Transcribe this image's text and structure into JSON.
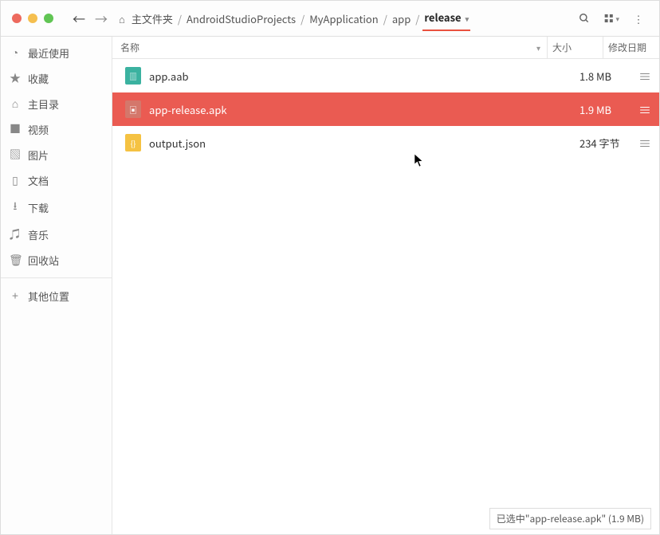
{
  "toolbar": {
    "back_enabled": true,
    "forward_enabled": false
  },
  "breadcrumb": {
    "home_label": "主文件夹",
    "sep": "/",
    "items": [
      "AndroidStudioProjects",
      "MyApplication",
      "app"
    ],
    "current": "release"
  },
  "sidebar": {
    "items": [
      {
        "icon": "recent",
        "label": "最近使用"
      },
      {
        "icon": "star",
        "label": "收藏"
      },
      {
        "icon": "home",
        "label": "主目录"
      },
      {
        "icon": "video",
        "label": "视频"
      },
      {
        "icon": "image",
        "label": "图片"
      },
      {
        "icon": "document",
        "label": "文档"
      },
      {
        "icon": "download",
        "label": "下载"
      },
      {
        "icon": "music",
        "label": "音乐"
      },
      {
        "icon": "trash",
        "label": "回收站"
      }
    ],
    "other_label": "其他位置"
  },
  "columns": {
    "name": "名称",
    "size": "大小",
    "date": "修改日期"
  },
  "files": [
    {
      "icon": "archive",
      "icon_color": "#3bb2a0",
      "name": "app.aab",
      "size": "1.8 MB",
      "selected": false
    },
    {
      "icon": "apk",
      "icon_color": "#d4776b",
      "name": "app-release.apk",
      "size": "1.9 MB",
      "selected": true
    },
    {
      "icon": "code",
      "icon_color": "#f5c242",
      "name": "output.json",
      "size": "234 字节",
      "selected": false
    }
  ],
  "status": "已选中\"app-release.apk\" (1.9 MB)"
}
